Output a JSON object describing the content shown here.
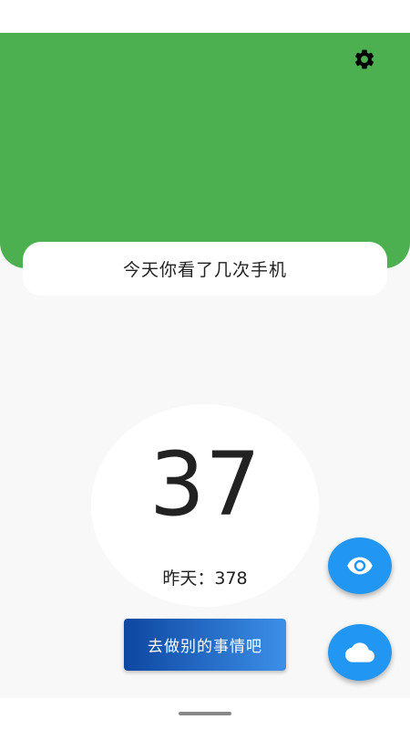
{
  "header": {
    "color": "#4caf50",
    "settings_icon": "gear-icon"
  },
  "title_card": {
    "text": "今天你看了几次手机"
  },
  "counter": {
    "today_count": "37",
    "yesterday_text": "昨天：378"
  },
  "action_button": {
    "label": "去做别的事情吧"
  },
  "fabs": {
    "eye_icon": "eye-icon",
    "cloud_icon": "cloud-icon",
    "color": "#2196f3"
  }
}
